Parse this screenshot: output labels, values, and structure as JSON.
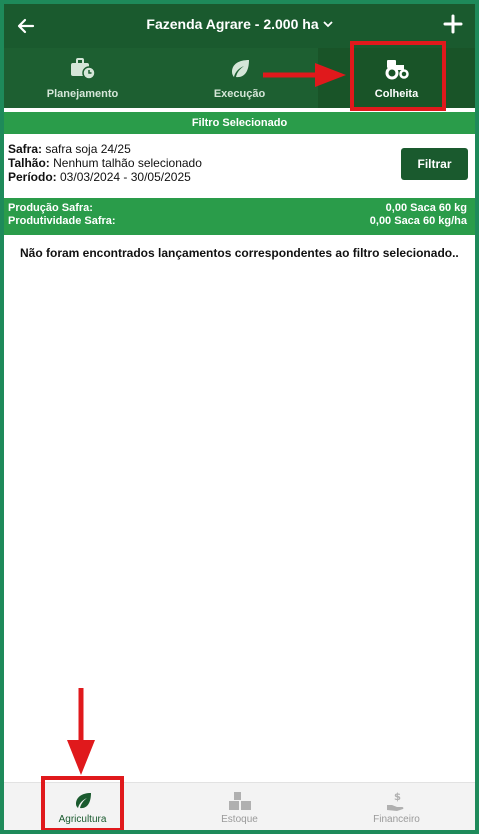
{
  "header": {
    "title": "Fazenda Agrare - 2.000 ha",
    "back_icon": "arrow-left-icon",
    "add_icon": "plus-icon"
  },
  "tabs": [
    {
      "label": "Planejamento",
      "icon": "briefcase-clock-icon"
    },
    {
      "label": "Execução",
      "icon": "leaf-icon"
    },
    {
      "label": "Colheita",
      "icon": "tractor-icon",
      "active": true
    }
  ],
  "filter": {
    "header": "Filtro Selecionado",
    "safra_label": "Safra:",
    "safra_value": " safra soja 24/25",
    "talhao_label": "Talhão:",
    "talhao_value": " Nenhum talhão selecionado",
    "periodo_label": "Período:",
    "periodo_value": " 03/03/2024 - 30/05/2025",
    "button_label": "Filtrar"
  },
  "summary": {
    "producao_label": "Produção Safra:",
    "producao_value": "0,00 Saca 60 kg",
    "produtividade_label": "Produtividade Safra:",
    "produtividade_value": "0,00 Saca 60 kg/ha"
  },
  "empty_message": "Não foram encontrados lançamentos correspondentes ao filtro selecionado..",
  "bottom_nav": [
    {
      "label": "Agricultura",
      "icon": "leaf-icon",
      "active": true
    },
    {
      "label": "Estoque",
      "icon": "boxes-icon"
    },
    {
      "label": "Financeiro",
      "icon": "hand-dollar-icon"
    }
  ],
  "colors": {
    "primary_dark": "#1a5a2e",
    "primary_green": "#2a9c4a",
    "annotation_red": "#e0191c"
  }
}
